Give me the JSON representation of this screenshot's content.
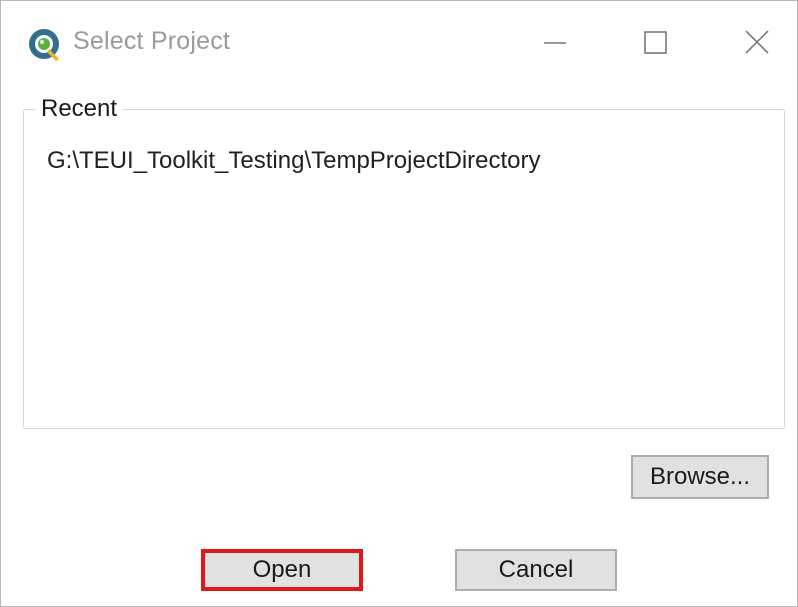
{
  "window": {
    "title": "Select Project",
    "app_icon": "qgis-icon",
    "controls": {
      "minimize_icon": "minimize-icon",
      "maximize_icon": "maximize-icon",
      "close_icon": "close-icon"
    }
  },
  "recent": {
    "label": "Recent",
    "items": [
      "G:\\TEUI_Toolkit_Testing\\TempProjectDirectory"
    ]
  },
  "buttons": {
    "browse": "Browse...",
    "open": "Open",
    "cancel": "Cancel"
  },
  "colors": {
    "highlight_border": "#e0161a",
    "button_bg": "#e1e1e1",
    "button_border": "#adadad",
    "title_text": "#9a9a9a"
  }
}
